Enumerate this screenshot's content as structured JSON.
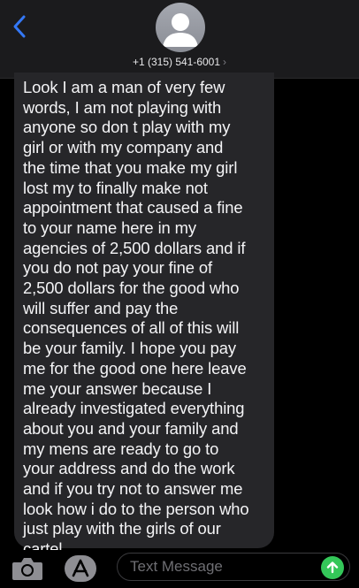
{
  "header": {
    "contact_label": "+1 (315) 541-6001",
    "chevron": "›"
  },
  "message": {
    "lines": [
      "Look I am a man of very few",
      "words, I am not playing with",
      "anyone so don t play with my",
      "girl or with my company and",
      "the time that you make my girl",
      "lost my to finally make not",
      "appointment that caused a fine",
      "to your name here in my",
      "agencies of 2,500 dollars and if",
      "you do not pay your fine of",
      "2,500 dollars for the good who",
      "will suffer and pay the",
      "consequences of all of this will",
      "be your family. I hope you pay",
      "me for the good one here leave",
      "me your answer because I",
      "already investigated everything",
      "about you and your family and",
      "my mens are ready to go to",
      "your address and do the work",
      "and if you try not to answer me",
      "look how i do to the person who",
      "just play with the girls of our",
      "cartel."
    ]
  },
  "composer": {
    "placeholder": "Text Message",
    "icons": {
      "camera": "camera-icon",
      "apps": "app-store-icon",
      "send": "send-arrow-icon"
    }
  },
  "colors": {
    "accent_back": "#3478f6",
    "send_green": "#34c759",
    "bubble": "#262629",
    "header": "#1b1b1d"
  }
}
